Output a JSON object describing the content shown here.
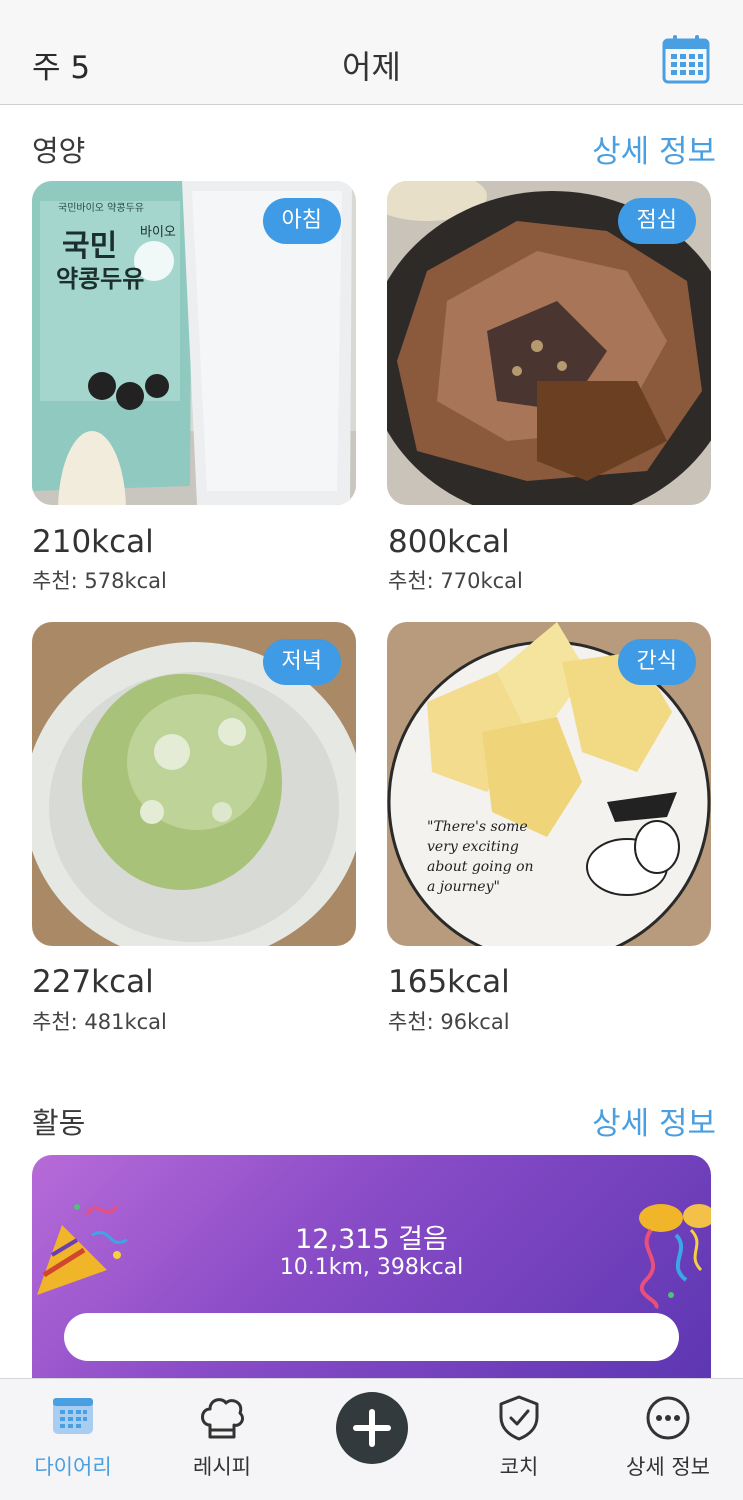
{
  "header": {
    "week": "주 5",
    "title": "어제",
    "calendar_icon": "calendar-icon"
  },
  "nutrition": {
    "title": "영양",
    "link": "상세 정보",
    "meals": [
      {
        "tag": "아침",
        "kcal": "210kcal",
        "recommend": "추천: 578kcal"
      },
      {
        "tag": "점심",
        "kcal": "800kcal",
        "recommend": "추천: 770kcal"
      },
      {
        "tag": "저녁",
        "kcal": "227kcal",
        "recommend": "추천: 481kcal"
      },
      {
        "tag": "간식",
        "kcal": "165kcal",
        "recommend": "추천: 96kcal"
      }
    ],
    "photo_text": {
      "soy_brand": "국민바이오 약콩두유",
      "soy_bio": "바이오",
      "soy_line1": "국민",
      "soy_line2": "약콩두유",
      "plate_text": [
        "\"There's some",
        "very exciting",
        "about going on",
        "a journey\""
      ]
    }
  },
  "activity": {
    "title": "활동",
    "link": "상세 정보",
    "steps": "12,315 걸음",
    "distance": "10.1km, 398kcal",
    "progress": 1.0
  },
  "tabs": [
    {
      "label": "다이어리",
      "icon": "calendar-icon",
      "active": true
    },
    {
      "label": "레시피",
      "icon": "chef-hat-icon",
      "active": false
    },
    {
      "label": "코치",
      "icon": "shield-check-icon",
      "active": false
    },
    {
      "label": "상세 정보",
      "icon": "more-icon",
      "active": false
    }
  ],
  "colors": {
    "accent": "#4a9fe1",
    "tag": "#3f9be6",
    "fab": "#333a3d"
  }
}
